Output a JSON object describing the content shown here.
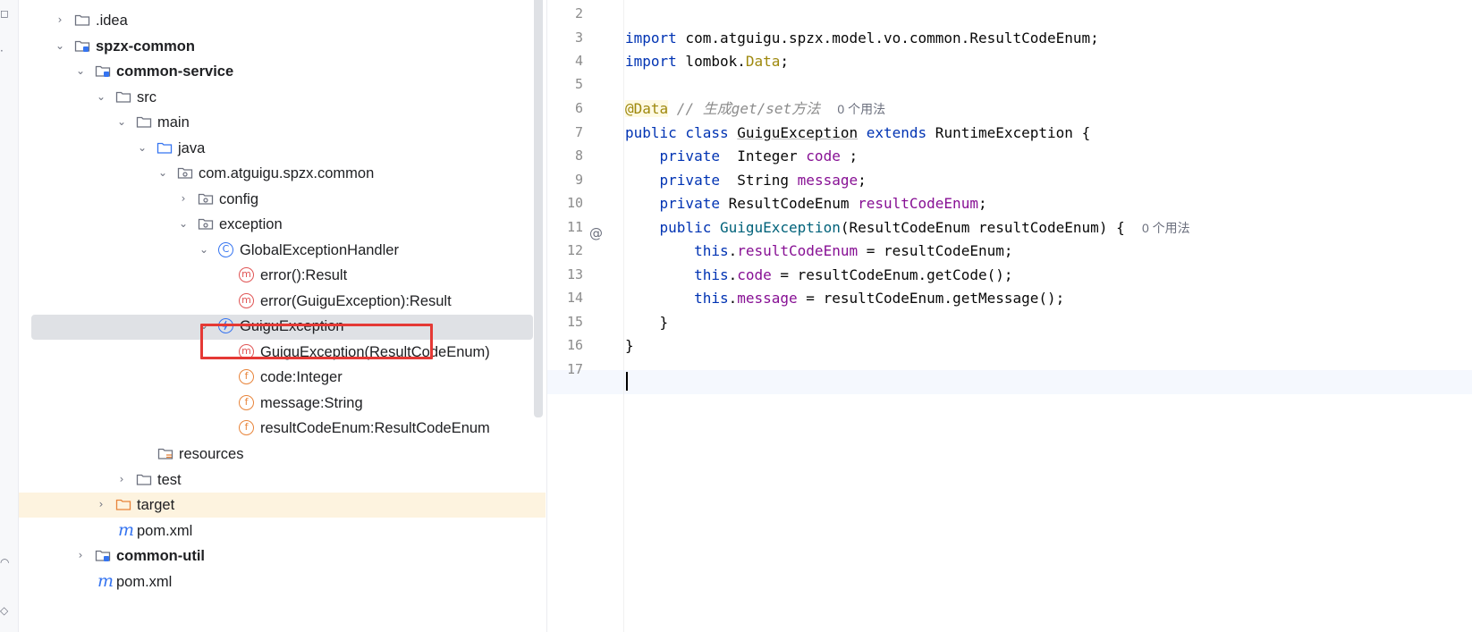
{
  "tree": {
    "rows": [
      {
        "label": ".idea",
        "chevron": "›",
        "icon": "folder"
      },
      {
        "label": "spzx-common",
        "chevron": "⌄",
        "icon": "module-folder"
      },
      {
        "label": "common-service",
        "chevron": "⌄",
        "icon": "module-folder"
      },
      {
        "label": "src",
        "chevron": "⌄",
        "icon": "folder"
      },
      {
        "label": "main",
        "chevron": "⌄",
        "icon": "folder"
      },
      {
        "label": "java",
        "chevron": "⌄",
        "icon": "source-folder"
      },
      {
        "label": "com.atguigu.spzx.common",
        "chevron": "⌄",
        "icon": "package"
      },
      {
        "label": "config",
        "chevron": "›",
        "icon": "package"
      },
      {
        "label": "exception",
        "chevron": "⌄",
        "icon": "package"
      },
      {
        "label": "GlobalExceptionHandler",
        "chevron": "⌄",
        "icon": "class"
      },
      {
        "label": "error():Result",
        "icon_text": "m"
      },
      {
        "label": "error(GuiguException):Result",
        "icon_text": "m"
      },
      {
        "label": "GuiguException",
        "chevron": "⌄",
        "icon": "exception-class"
      },
      {
        "label": "GuiguException(ResultCodeEnum)",
        "icon_text": "m"
      },
      {
        "label": "code:Integer",
        "icon_text": "f"
      },
      {
        "label": "message:String",
        "icon_text": "f"
      },
      {
        "label": "resultCodeEnum:ResultCodeEnum",
        "icon_text": "f"
      },
      {
        "label": "resources",
        "icon": "resources-folder"
      },
      {
        "label": "test",
        "chevron": "›",
        "icon": "folder"
      },
      {
        "label": "target",
        "chevron": "›",
        "icon": "excluded-folder"
      },
      {
        "label": "pom.xml",
        "icon_text": "m"
      },
      {
        "label": "common-util",
        "chevron": "›",
        "icon": "module-folder"
      },
      {
        "label": "pom.xml",
        "icon_text": "m"
      }
    ],
    "class_icon_text": "C"
  },
  "editor": {
    "line_numbers": [
      "2",
      "3",
      "4",
      "5",
      "6",
      "7",
      "8",
      "9",
      "10",
      "11",
      "12",
      "13",
      "14",
      "15",
      "16",
      "17"
    ],
    "line3": {
      "kw": "import",
      "rest": " com.atguigu.spzx.model.vo.common.ResultCodeEnum;"
    },
    "line4": {
      "kw": "import",
      "mid": " lombok.",
      "ann": "Data",
      "end": ";"
    },
    "line6": {
      "ann": "@Data",
      "cmt": " // 生成get/set方法",
      "hint": "0 个用法"
    },
    "line7": {
      "kw1": "public class",
      "cls": "GuiguException",
      "kw2": "extends",
      "rest": " RuntimeException {"
    },
    "line8": {
      "kw": "private",
      "type": "  Integer ",
      "fld": "code",
      "end": " ;"
    },
    "line9": {
      "kw": "private",
      "type": "  String ",
      "fld": "message",
      "end": ";"
    },
    "line10": {
      "kw": "private",
      "type": " ResultCodeEnum ",
      "fld": "resultCodeEnum",
      "end": ";"
    },
    "line11": {
      "kw": "public",
      "cls": "GuiguException",
      "rest": "(ResultCodeEnum resultCodeEnum) {",
      "hint": "0 个用法",
      "gutter_mark": "@"
    },
    "line12": {
      "kw": "this",
      "dot": ".",
      "fld": "resultCodeEnum",
      "rest": " = resultCodeEnum;"
    },
    "line13": {
      "kw": "this",
      "dot": ".",
      "fld": "code",
      "rest": " = resultCodeEnum.getCode();"
    },
    "line14": {
      "kw": "this",
      "dot": ".",
      "fld": "message",
      "rest": " = resultCodeEnum.getMessage();"
    },
    "line15": "}",
    "line16": "}"
  },
  "colors": {
    "keyword": "#0033b3",
    "annotation": "#9e880d",
    "field": "#871094",
    "class_decl": "#00627a",
    "highlight_box": "#e53935"
  }
}
